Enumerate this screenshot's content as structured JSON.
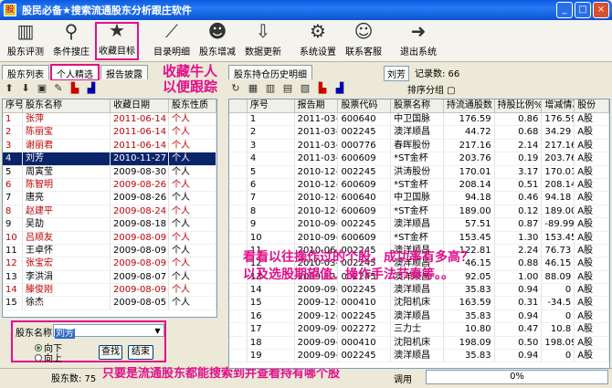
{
  "window": {
    "title": "股民必备★搜索流通股东分析跟庄软件",
    "buttons": [
      "_",
      "□",
      "×"
    ]
  },
  "toolbar": [
    {
      "label": "股东评测",
      "icon": "bar-chart-icon",
      "glyph": "▥"
    },
    {
      "label": "条件搜庄",
      "icon": "magnifier-icon",
      "glyph": "⚲"
    },
    {
      "label": "收藏目标",
      "icon": "star-icon",
      "glyph": "★"
    },
    {
      "label": "目录明细",
      "icon": "trend-chart-icon",
      "glyph": "⟋"
    },
    {
      "label": "股东增减",
      "icon": "add-user-icon",
      "glyph": "☻"
    },
    {
      "label": "数据更新",
      "icon": "download-icon",
      "glyph": "⇩"
    },
    {
      "label": "系统设置",
      "icon": "gear-icon",
      "glyph": "⚙"
    },
    {
      "label": "联系客服",
      "icon": "smiley-icon",
      "glyph": "☺"
    },
    {
      "label": "退出系统",
      "icon": "exit-arrow-icon",
      "glyph": "➜"
    }
  ],
  "left": {
    "tabs": [
      "股东列表",
      "个人精选",
      "报告披露"
    ],
    "annotation": "收藏牛人\n以便跟踪",
    "columns": [
      "序号",
      "股东名称",
      "收藏日期",
      "股东性质"
    ],
    "rows": [
      [
        "1",
        "张萍",
        "2011-06-14",
        "个人",
        true
      ],
      [
        "2",
        "陈丽宝",
        "2011-06-14",
        "个人",
        true
      ],
      [
        "3",
        "谢丽君",
        "2011-06-14",
        "个人",
        true
      ],
      [
        "4",
        "刘芳",
        "2010-11-27",
        "个人",
        false,
        true
      ],
      [
        "5",
        "周寅莹",
        "2009-08-30",
        "个人",
        false
      ],
      [
        "6",
        "陈智明",
        "2009-08-26",
        "个人",
        true
      ],
      [
        "7",
        "唐亮",
        "2009-08-26",
        "个人",
        false
      ],
      [
        "8",
        "赵建平",
        "2009-08-24",
        "个人",
        true
      ],
      [
        "9",
        "吴劼",
        "2009-08-18",
        "个人",
        false
      ],
      [
        "10",
        "吕顺友",
        "2009-08-09",
        "个人",
        true
      ],
      [
        "11",
        "王卓怀",
        "2009-08-09",
        "个人",
        false
      ],
      [
        "12",
        "张宝宏",
        "2009-08-09",
        "个人",
        true
      ],
      [
        "13",
        "李洪涓",
        "2009-08-07",
        "个人",
        false
      ],
      [
        "14",
        "滕俊刚",
        "2009-08-09",
        "个人",
        true
      ],
      [
        "15",
        "徐杰",
        "2009-08-05",
        "个人",
        false
      ]
    ],
    "search": {
      "label": "股东名称",
      "value": "刘芳",
      "dir_down": "向下",
      "dir_up": "向上",
      "find": "查找",
      "end": "结束"
    },
    "total": "股东数: 75"
  },
  "right": {
    "tab": "股东持仓历史明细",
    "holder_name": "刘芳",
    "record_count": "记录数: 66",
    "sort_label": "排序分组",
    "columns": [
      "序号",
      "报告期",
      "股票代码",
      "股票名称",
      "持流通股数",
      "持股比例%",
      "增减情况",
      "股份"
    ],
    "rows": [
      [
        "1",
        "2011-03-31",
        "600640",
        "中卫国脉",
        "176.59",
        "0.86",
        "176.59",
        "A股"
      ],
      [
        "2",
        "2011-03-31",
        "002245",
        "澳洋顺昌",
        "44.72",
        "0.68",
        "34.29",
        "A股"
      ],
      [
        "3",
        "2011-03-31",
        "000776",
        "春晖股份",
        "217.16",
        "2.14",
        "217.16",
        "A股"
      ],
      [
        "4",
        "2011-03-31",
        "600609",
        "*ST金杯",
        "203.76",
        "0.19",
        "203.76",
        "A股"
      ],
      [
        "5",
        "2010-12-31",
        "002245",
        "洪涛股份",
        "170.01",
        "3.17",
        "170.01",
        "A股"
      ],
      [
        "6",
        "2010-12-31",
        "600609",
        "*ST金杯",
        "208.14",
        "0.51",
        "208.14",
        "A股"
      ],
      [
        "7",
        "2010-12-31",
        "600640",
        "中卫国脉",
        "94.18",
        "0.46",
        "94.18",
        "A股"
      ],
      [
        "8",
        "2010-12-31",
        "600609",
        "*ST金杯",
        "189.00",
        "0.12",
        "189.00",
        "A股"
      ],
      [
        "9",
        "2010-09-30",
        "002245",
        "澳洋顺昌",
        "57.51",
        "0.87",
        "-89.99",
        "A股"
      ],
      [
        "10",
        "2010-09-30",
        "600609",
        "*ST金杯",
        "153.45",
        "1.30",
        "153.45",
        "A股"
      ],
      [
        "11",
        "2010-06-30",
        "002245",
        "澳洋顺昌",
        "122.81",
        "2.24",
        "76.73",
        "A股"
      ],
      [
        "12",
        "2010-03-31",
        "002245",
        "澳洋顺昌",
        "46.15",
        "0.88",
        "46.15",
        "A股"
      ],
      [
        "13",
        "2009-12-31",
        "002245",
        "澳洋顺昌",
        "92.05",
        "1.00",
        "88.09",
        "A股"
      ],
      [
        "14",
        "2009-09-30",
        "002245",
        "澳洋顺昌",
        "35.83",
        "0.94",
        "0",
        "A股"
      ],
      [
        "15",
        "2009-12-31",
        "000410",
        "沈阳机床",
        "163.59",
        "0.31",
        "-34.5",
        "A股"
      ],
      [
        "16",
        "2009-12-31",
        "002245",
        "澳洋顺昌",
        "35.83",
        "0.94",
        "0",
        "A股"
      ],
      [
        "17",
        "2009-09-30",
        "002272",
        "三力士",
        "10.80",
        "0.47",
        "10.8",
        "A股"
      ],
      [
        "18",
        "2009-09-30",
        "000410",
        "沈阳机床",
        "198.09",
        "0.50",
        "198.09",
        "A股"
      ],
      [
        "19",
        "2009-09-30",
        "002245",
        "澳洋顺昌",
        "35.83",
        "0.94",
        "0",
        "A股"
      ]
    ],
    "overlay_line1": "看看以往操作过的个股，成功率有多高？",
    "overlay_line2": "以及选股期望值、操作手法节奏等。。"
  },
  "bottom_note": "只要是流通股东都能搜索到并查看持有哪个股",
  "status": {
    "left": "调用",
    "progress": "0%"
  },
  "colors": {
    "title": "#0a5ae0",
    "annotation": "#e0108a",
    "selected_row": "#0a246a",
    "red_text": "#c00000"
  }
}
